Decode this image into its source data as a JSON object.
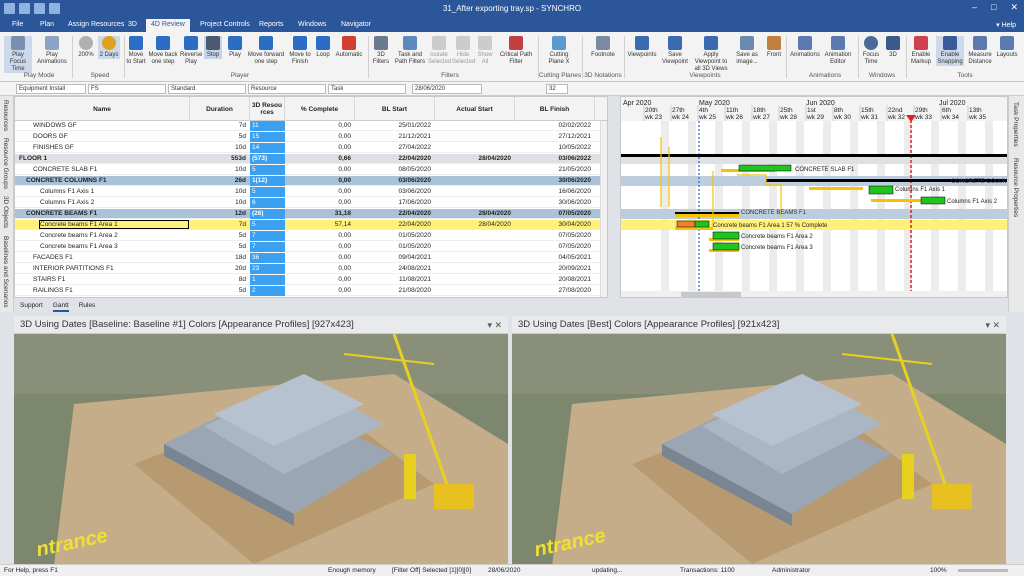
{
  "window": {
    "title": "31_After exporting tray.sp - SYNCHRO",
    "min": "–",
    "max": "□",
    "close": "✕"
  },
  "menu": {
    "tabs": [
      "File",
      "Plan",
      "Assign Resources",
      "3D",
      "4D Review",
      "Project Controls",
      "Reports",
      "Windows",
      "Navigator"
    ],
    "active": "4D Review",
    "help": "Help"
  },
  "ribbon": {
    "play_mode": {
      "play_focus": "Play Focus Time",
      "play_anim": "Play Animations",
      "group": "Play Mode"
    },
    "speed": {
      "pct": "200%",
      "days": "2 Days",
      "group": "Speed"
    },
    "player": {
      "move_start": "Move to Start",
      "move_back": "Move back one step",
      "reverse": "Reverse Play",
      "stop": "Stop",
      "play": "Play",
      "move_fwd": "Move forward one step",
      "move_finish": "Move to Finish",
      "loop": "Loop",
      "automatic": "Automatic",
      "group": "Player"
    },
    "filters": {
      "f3d": "3D Filters",
      "task_path": "Task and Path Filters",
      "isolate": "Isolate Selected",
      "hide": "Hide Selected",
      "show_all": "Show All",
      "critical": "Critical Path Filter",
      "group": "Filters"
    },
    "cutting": {
      "label": "Cutting Plane X",
      "group": "Cutting Planes"
    },
    "notations": {
      "label": "Footnote",
      "group": "3D Notations"
    },
    "viewpoints": {
      "vp": "Viewpoints",
      "save_vp": "Save Viewpoint",
      "apply_vp": "Apply Viewpoint to all 3D Views",
      "save_img": "Save as image...",
      "front": "Front",
      "group": "Viewpoints"
    },
    "animations": {
      "anim": "Animations",
      "editor": "Animation Editor",
      "group": "Animations"
    },
    "windows": {
      "focus": "Focus Time",
      "d3": "3D",
      "group": "Windows"
    },
    "tools": {
      "markup": "Enable Markup",
      "snapping": "Enable Snapping",
      "measure": "Measure Distance",
      "layouts": "Layouts",
      "group": "Tools"
    }
  },
  "filterbar": {
    "f1": "Equipment Install",
    "f2": "FS",
    "f3": "Standard",
    "f4": "Resource",
    "f5": "Task",
    "date": "28/06/2020",
    "num": "32"
  },
  "sidebar_left": [
    "Resources",
    "Resource Groups",
    "3D Objects",
    "Baselines and Scenarios"
  ],
  "sidebar_right": [
    "Task Properties",
    "Resource Properties"
  ],
  "grid": {
    "headers": {
      "name": "Name",
      "duration": "Duration",
      "res": "3D Resou rces",
      "pct": "% Complete",
      "bl_start": "BL Start",
      "actual_start": "Actual Start",
      "bl_finish": "BL Finish"
    },
    "rows": [
      {
        "name": "WINDOWS GF",
        "dur": "7d",
        "res": "11",
        "pct": "0,00",
        "bls": "25/01/2022",
        "as": "",
        "blf": "02/02/2022",
        "lvl": 2,
        "t": "n"
      },
      {
        "name": "DOORS GF",
        "dur": "5d",
        "res": "15",
        "pct": "0,00",
        "bls": "21/12/2021",
        "as": "",
        "blf": "27/12/2021",
        "lvl": 2,
        "t": "n"
      },
      {
        "name": "FINISHES GF",
        "dur": "10d",
        "res": "14",
        "pct": "0,00",
        "bls": "27/04/2022",
        "as": "",
        "blf": "10/05/2022",
        "lvl": 2,
        "t": "n"
      },
      {
        "name": "FLOOR 1",
        "dur": "553d",
        "res": "(573)",
        "pct": "0,66",
        "bls": "22/04/2020",
        "as": "28/04/2020",
        "blf": "03/06/2022",
        "lvl": 0,
        "t": "s1"
      },
      {
        "name": "CONCRETE SLAB F1",
        "dur": "10d",
        "res": "5",
        "pct": "0,00",
        "bls": "08/05/2020",
        "as": "",
        "blf": "21/05/2020",
        "lvl": 2,
        "t": "n"
      },
      {
        "name": "CONCRETE COLUMNS F1",
        "dur": "26d",
        "res": "1(12)",
        "pct": "0,00",
        "bls": "03/06/2020",
        "as": "",
        "blf": "30/06/2020",
        "lvl": 1,
        "t": "s2"
      },
      {
        "name": "Columns F1 Axis 1",
        "dur": "10d",
        "res": "5",
        "pct": "0,00",
        "bls": "03/06/2020",
        "as": "",
        "blf": "16/06/2020",
        "lvl": 3,
        "t": "n"
      },
      {
        "name": "Columns F1 Axis 2",
        "dur": "10d",
        "res": "6",
        "pct": "0,00",
        "bls": "17/06/2020",
        "as": "",
        "blf": "30/06/2020",
        "lvl": 3,
        "t": "n"
      },
      {
        "name": "CONCRETE BEAMS F1",
        "dur": "12d",
        "res": "(26)",
        "pct": "31,18",
        "bls": "22/04/2020",
        "as": "28/04/2020",
        "blf": "07/05/2020",
        "lvl": 1,
        "t": "s2"
      },
      {
        "name": "Concrete beams F1 Area 1",
        "dur": "7d",
        "res": "5",
        "pct": "57,14",
        "bls": "22/04/2020",
        "as": "28/04/2020",
        "blf": "30/04/2020",
        "lvl": 3,
        "t": "sel"
      },
      {
        "name": "Concrete beams F1 Area 2",
        "dur": "5d",
        "res": "7",
        "pct": "0,00",
        "bls": "01/05/2020",
        "as": "",
        "blf": "07/05/2020",
        "lvl": 3,
        "t": "n"
      },
      {
        "name": "Concrete beams F1 Area 3",
        "dur": "5d",
        "res": "7",
        "pct": "0,00",
        "bls": "01/05/2020",
        "as": "",
        "blf": "07/05/2020",
        "lvl": 3,
        "t": "n"
      },
      {
        "name": "FACADES F1",
        "dur": "18d",
        "res": "36",
        "pct": "0,00",
        "bls": "09/04/2021",
        "as": "",
        "blf": "04/05/2021",
        "lvl": 2,
        "t": "n"
      },
      {
        "name": "INTERIOR PARTITIONS F1",
        "dur": "20d",
        "res": "23",
        "pct": "0,00",
        "bls": "24/08/2021",
        "as": "",
        "blf": "20/09/2021",
        "lvl": 2,
        "t": "n"
      },
      {
        "name": "STAIRS F1",
        "dur": "8d",
        "res": "1",
        "pct": "0,00",
        "bls": "11/08/2021",
        "as": "",
        "blf": "20/08/2021",
        "lvl": 2,
        "t": "n"
      },
      {
        "name": "RAILINGS F1",
        "dur": "5d",
        "res": "2",
        "pct": "0,00",
        "bls": "21/08/2020",
        "as": "",
        "blf": "27/08/2020",
        "lvl": 2,
        "t": "n"
      }
    ]
  },
  "gantt": {
    "months": [
      "Apr 2020",
      "May 2020",
      "Jun 2020",
      "Jul 2020"
    ],
    "weeks": [
      "20th",
      "27th",
      "4th",
      "11th",
      "18th",
      "25th",
      "1st",
      "8th",
      "15th",
      "22nd",
      "29th",
      "6th",
      "13th"
    ],
    "wks": [
      "wk 23",
      "wk 24",
      "wk 25",
      "wk 26",
      "wk 27",
      "wk 28",
      "wk 29",
      "wk 30",
      "wk 31",
      "wk 32",
      "wk 33",
      "wk 34",
      "wk 35"
    ],
    "labels": {
      "slab": "CONCRETE SLAB F1",
      "columns": "CONCRETE COLUMNS F",
      "axis1": "Columns F1 Axis 1",
      "axis2": "Columns F1 Axis 2",
      "beams": "CONCRETE BEAMS F1",
      "area1": "Concrete beams F1 Area 1  57 % Complete",
      "area2": "Concrete beams F1 Area 2",
      "area3": "Concrete beams F1 Area 3"
    }
  },
  "bottom_tabs": [
    "Support",
    "Gantt",
    "Rules"
  ],
  "views": {
    "left": {
      "title": "3D Using Dates [Baseline: Baseline #1] Colors [Appearance Profiles]  [927x423]",
      "overlay": "ntrance"
    },
    "right": {
      "title": "3D Using Dates [Best] Colors [Appearance Profiles]  [921x423]",
      "overlay": "ntrance"
    }
  },
  "statusbar": {
    "help": "For Help, press F1",
    "memory": "Enough memory",
    "filter": "[Filter Off]  Selected [1][0][0]",
    "date": "28/06/2020",
    "updating": "updating...",
    "transactions": "Transactions: 1100",
    "user": "Administrator",
    "zoom": "100%"
  },
  "colors": {
    "accent": "#2b579a",
    "summary_bar": "#000000",
    "baseline_bar": "#f5c400",
    "progress_bar": "#1fc41f",
    "today_line": "#e02020",
    "status_line": "#2060d0",
    "res_cell": "#3ca0f0",
    "selected_row": "#fff07a"
  }
}
